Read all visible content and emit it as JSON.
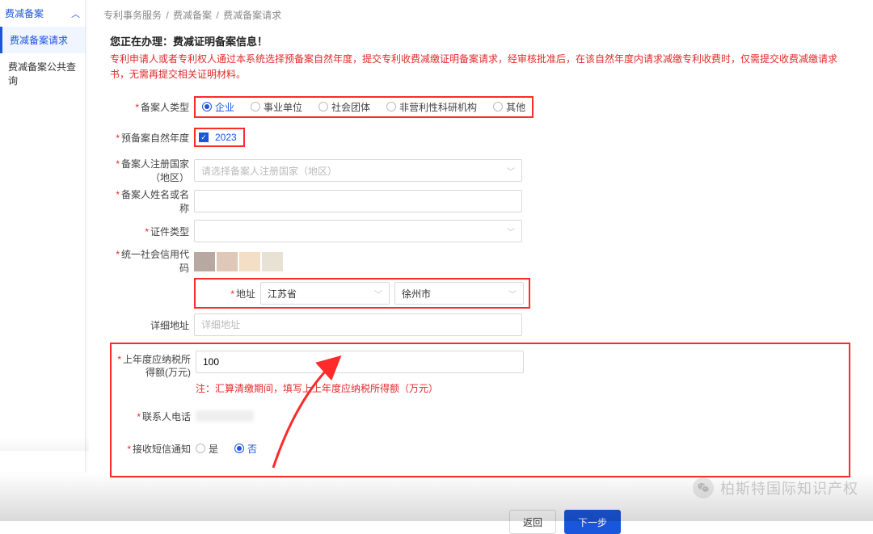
{
  "sidebar": {
    "header": "费减备案",
    "items": [
      "费减备案请求",
      "费减备案公共查询"
    ]
  },
  "breadcrumb": [
    "专利事务服务",
    "费减备案",
    "费减备案请求"
  ],
  "notice": {
    "title": "您正在办理：费减证明备案信息！",
    "warn": "专利申请人或者专利权人通过本系统选择预备案自然年度，提交专利收费减缴证明备案请求，经审核批准后，在该自然年度内请求减缴专利收费时，仅需提交收费减缴请求书，无需再提交相关证明材料。"
  },
  "labels": {
    "type": "备案人类型",
    "year": "预备案自然年度",
    "regCountry": "备案人注册国家（地区）",
    "name": "备案人姓名或名称",
    "idType": "证件类型",
    "creditCode": "统一社会信用代码",
    "addr": "地址",
    "detailAddr": "详细地址",
    "tax": "上年度应纳税所得额(万元)",
    "phone": "联系人电话",
    "sms": "接收短信通知"
  },
  "radios": {
    "type": [
      "企业",
      "事业单位",
      "社会团体",
      "非营利性科研机构",
      "其他"
    ],
    "sms": [
      "是",
      "否"
    ]
  },
  "values": {
    "year": "2023",
    "province": "江苏省",
    "city": "徐州市",
    "tax": "100",
    "regCountryPlaceholder": "请选择备案人注册国家（地区）",
    "detailAddrPlaceholder": "详细地址",
    "taxHint": "注：汇算清缴期间，填写上上年度应纳税所得额（万元）"
  },
  "buttons": {
    "back": "返回",
    "next": "下一步"
  },
  "watermark": "柏斯特国际知识产权"
}
